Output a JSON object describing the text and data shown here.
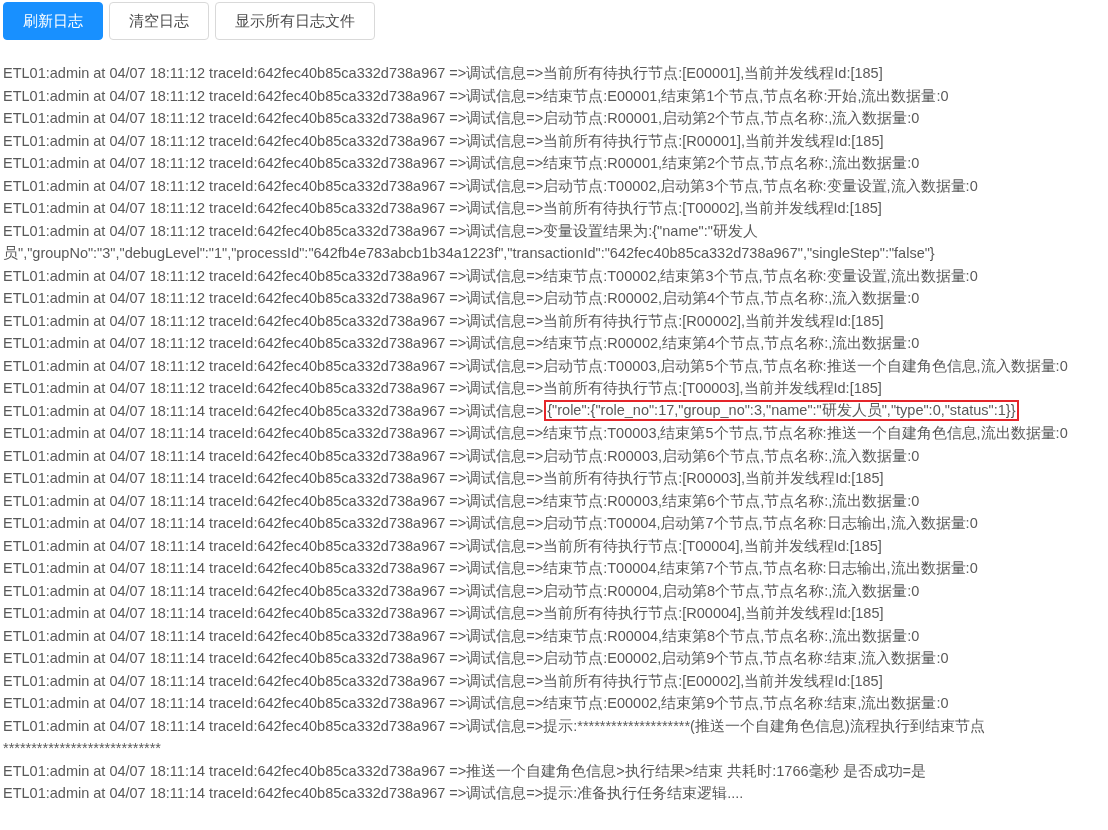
{
  "toolbar": {
    "buttons": [
      {
        "label": "刷新日志",
        "kind": "primary"
      },
      {
        "label": "清空日志",
        "kind": "default"
      },
      {
        "label": "显示所有日志文件",
        "kind": "default"
      }
    ]
  },
  "log": {
    "lines": [
      {
        "kind": "plain",
        "text": "ETL01:admin at 04/07 18:11:12 traceId:642fec40b85ca332d738a967 =>调试信息=>当前所有待执行节点:[E00001],当前并发线程Id:[185]"
      },
      {
        "kind": "plain",
        "text": "ETL01:admin at 04/07 18:11:12 traceId:642fec40b85ca332d738a967 =>调试信息=>结束节点:E00001,结束第1个节点,节点名称:开始,流出数据量:0"
      },
      {
        "kind": "plain",
        "text": "ETL01:admin at 04/07 18:11:12 traceId:642fec40b85ca332d738a967 =>调试信息=>启动节点:R00001,启动第2个节点,节点名称:,流入数据量:0"
      },
      {
        "kind": "plain",
        "text": "ETL01:admin at 04/07 18:11:12 traceId:642fec40b85ca332d738a967 =>调试信息=>当前所有待执行节点:[R00001],当前并发线程Id:[185]"
      },
      {
        "kind": "plain",
        "text": "ETL01:admin at 04/07 18:11:12 traceId:642fec40b85ca332d738a967 =>调试信息=>结束节点:R00001,结束第2个节点,节点名称:,流出数据量:0"
      },
      {
        "kind": "plain",
        "text": "ETL01:admin at 04/07 18:11:12 traceId:642fec40b85ca332d738a967 =>调试信息=>启动节点:T00002,启动第3个节点,节点名称:变量设置,流入数据量:0"
      },
      {
        "kind": "plain",
        "text": "ETL01:admin at 04/07 18:11:12 traceId:642fec40b85ca332d738a967 =>调试信息=>当前所有待执行节点:[T00002],当前并发线程Id:[185]"
      },
      {
        "kind": "plain",
        "text": "ETL01:admin at 04/07 18:11:12 traceId:642fec40b85ca332d738a967 =>调试信息=>变量设置结果为:{\"name\":\"研发人员\",\"groupNo\":\"3\",\"debugLevel\":\"1\",\"processId\":\"642fb4e783abcb1b34a1223f\",\"transactionId\":\"642fec40b85ca332d738a967\",\"singleStep\":\"false\"}"
      },
      {
        "kind": "plain",
        "text": "ETL01:admin at 04/07 18:11:12 traceId:642fec40b85ca332d738a967 =>调试信息=>结束节点:T00002,结束第3个节点,节点名称:变量设置,流出数据量:0"
      },
      {
        "kind": "plain",
        "text": "ETL01:admin at 04/07 18:11:12 traceId:642fec40b85ca332d738a967 =>调试信息=>启动节点:R00002,启动第4个节点,节点名称:,流入数据量:0"
      },
      {
        "kind": "plain",
        "text": "ETL01:admin at 04/07 18:11:12 traceId:642fec40b85ca332d738a967 =>调试信息=>当前所有待执行节点:[R00002],当前并发线程Id:[185]"
      },
      {
        "kind": "plain",
        "text": "ETL01:admin at 04/07 18:11:12 traceId:642fec40b85ca332d738a967 =>调试信息=>结束节点:R00002,结束第4个节点,节点名称:,流出数据量:0"
      },
      {
        "kind": "plain",
        "text": "ETL01:admin at 04/07 18:11:12 traceId:642fec40b85ca332d738a967 =>调试信息=>启动节点:T00003,启动第5个节点,节点名称:推送一个自建角色信息,流入数据量:0"
      },
      {
        "kind": "plain",
        "text": "ETL01:admin at 04/07 18:11:12 traceId:642fec40b85ca332d738a967 =>调试信息=>当前所有待执行节点:[T00003],当前并发线程Id:[185]"
      },
      {
        "kind": "annotated",
        "text": "ETL01:admin at 04/07 18:11:14 traceId:642fec40b85ca332d738a967 =>调试信息=>",
        "boxed": "{\"role\":{\"role_no\":17,\"group_no\":3,\"name\":\"研发人员\",\"type\":0,\"status\":1}}"
      },
      {
        "kind": "plain",
        "text": "ETL01:admin at 04/07 18:11:14 traceId:642fec40b85ca332d738a967 =>调试信息=>结束节点:T00003,结束第5个节点,节点名称:推送一个自建角色信息,流出数据量:0"
      },
      {
        "kind": "plain",
        "text": "ETL01:admin at 04/07 18:11:14 traceId:642fec40b85ca332d738a967 =>调试信息=>启动节点:R00003,启动第6个节点,节点名称:,流入数据量:0"
      },
      {
        "kind": "plain",
        "text": "ETL01:admin at 04/07 18:11:14 traceId:642fec40b85ca332d738a967 =>调试信息=>当前所有待执行节点:[R00003],当前并发线程Id:[185]"
      },
      {
        "kind": "plain",
        "text": "ETL01:admin at 04/07 18:11:14 traceId:642fec40b85ca332d738a967 =>调试信息=>结束节点:R00003,结束第6个节点,节点名称:,流出数据量:0"
      },
      {
        "kind": "plain",
        "text": "ETL01:admin at 04/07 18:11:14 traceId:642fec40b85ca332d738a967 =>调试信息=>启动节点:T00004,启动第7个节点,节点名称:日志输出,流入数据量:0"
      },
      {
        "kind": "plain",
        "text": "ETL01:admin at 04/07 18:11:14 traceId:642fec40b85ca332d738a967 =>调试信息=>当前所有待执行节点:[T00004],当前并发线程Id:[185]"
      },
      {
        "kind": "plain",
        "text": "ETL01:admin at 04/07 18:11:14 traceId:642fec40b85ca332d738a967 =>调试信息=>结束节点:T00004,结束第7个节点,节点名称:日志输出,流出数据量:0"
      },
      {
        "kind": "plain",
        "text": "ETL01:admin at 04/07 18:11:14 traceId:642fec40b85ca332d738a967 =>调试信息=>启动节点:R00004,启动第8个节点,节点名称:,流入数据量:0"
      },
      {
        "kind": "plain",
        "text": "ETL01:admin at 04/07 18:11:14 traceId:642fec40b85ca332d738a967 =>调试信息=>当前所有待执行节点:[R00004],当前并发线程Id:[185]"
      },
      {
        "kind": "plain",
        "text": "ETL01:admin at 04/07 18:11:14 traceId:642fec40b85ca332d738a967 =>调试信息=>结束节点:R00004,结束第8个节点,节点名称:,流出数据量:0"
      },
      {
        "kind": "plain",
        "text": "ETL01:admin at 04/07 18:11:14 traceId:642fec40b85ca332d738a967 =>调试信息=>启动节点:E00002,启动第9个节点,节点名称:结束,流入数据量:0"
      },
      {
        "kind": "plain",
        "text": "ETL01:admin at 04/07 18:11:14 traceId:642fec40b85ca332d738a967 =>调试信息=>当前所有待执行节点:[E00002],当前并发线程Id:[185]"
      },
      {
        "kind": "plain",
        "text": "ETL01:admin at 04/07 18:11:14 traceId:642fec40b85ca332d738a967 =>调试信息=>结束节点:E00002,结束第9个节点,节点名称:结束,流出数据量:0"
      },
      {
        "kind": "plain",
        "text": "ETL01:admin at 04/07 18:11:14 traceId:642fec40b85ca332d738a967 =>调试信息=>提示:********************(推送一个自建角色信息)流程执行到结束节点****************************"
      },
      {
        "kind": "plain",
        "text": "ETL01:admin at 04/07 18:11:14 traceId:642fec40b85ca332d738a967 =>推送一个自建角色信息>执行结果>结束 共耗时:1766毫秒 是否成功=是"
      },
      {
        "kind": "plain",
        "text": "ETL01:admin at 04/07 18:11:14 traceId:642fec40b85ca332d738a967 =>调试信息=>提示:准备执行任务结束逻辑...."
      }
    ]
  }
}
